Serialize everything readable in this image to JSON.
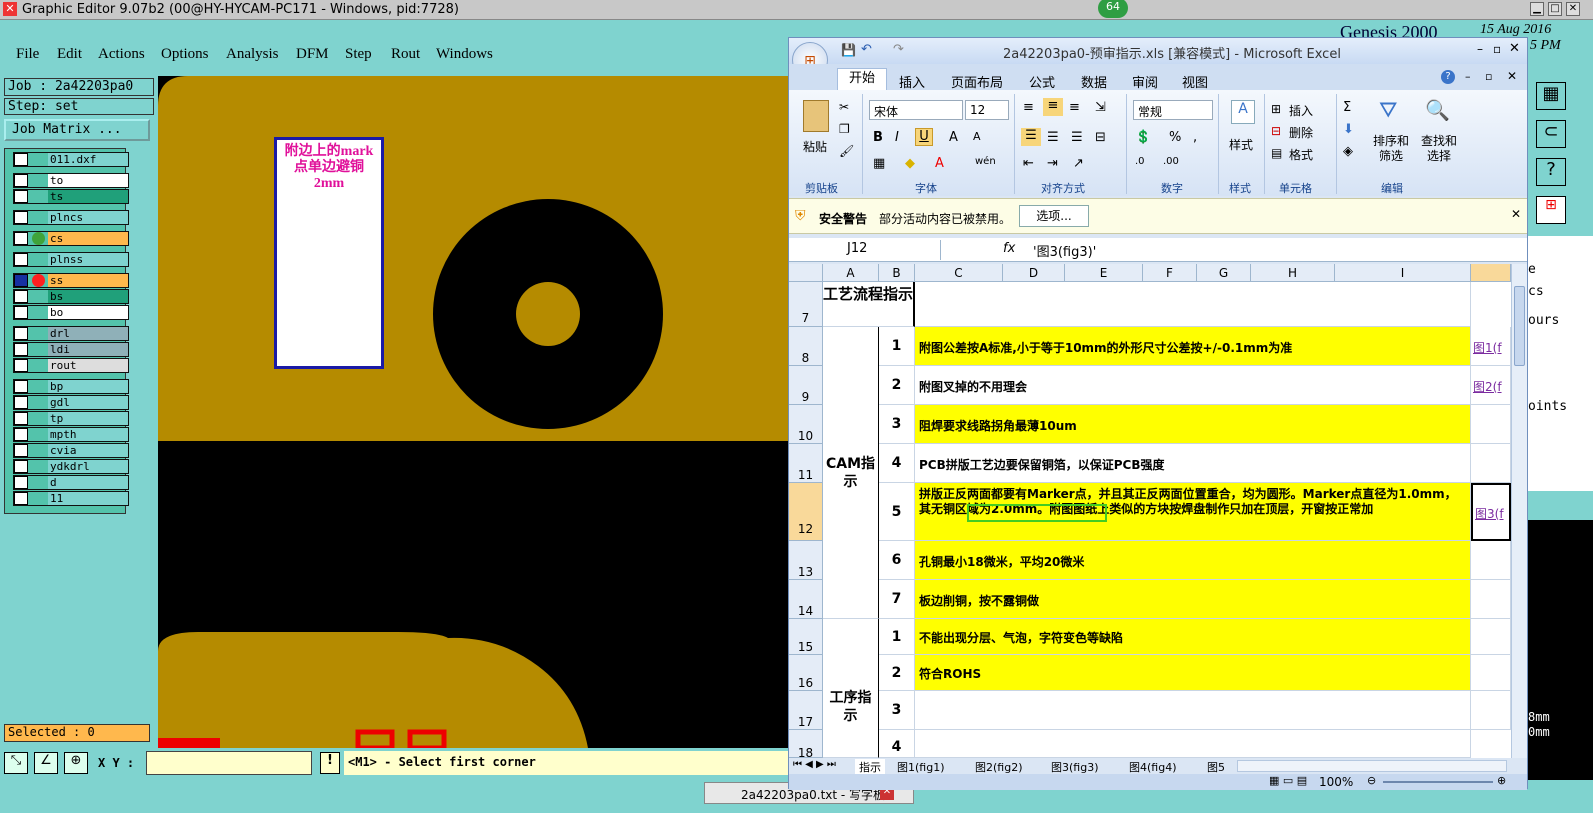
{
  "genesis": {
    "title": "Graphic Editor 9.07b2 (00@HY-HYCAM-PC171 - Windows, pid:7728)",
    "menu": [
      "File",
      "Edit",
      "Actions",
      "Options",
      "Analysis",
      "DFM",
      "Step",
      "Rout",
      "Windows"
    ],
    "badge": "64",
    "brand": "Genesis 2000",
    "date": "15 Aug 2016",
    "time": "5 PM",
    "job": "Job : 2a42203pa0",
    "step": "Step: set",
    "job_matrix": "Job Matrix ...",
    "layers": [
      "011.dxf",
      "to",
      "ts",
      "plncs",
      "cs",
      "plnss",
      "ss",
      "bs",
      "bo",
      "drl",
      "ldi",
      "rout",
      "bp",
      "gdl",
      "tp",
      "mpth",
      "cvia",
      "ydkdrl",
      "d",
      "11"
    ],
    "selected": "Selected : 0",
    "xy_label": "X Y :",
    "xy_value": "",
    "status": "<M1> - Select first corner",
    "annotation": "附边上的mark点单边避铜2mm",
    "right_fragments": [
      "e",
      "cs",
      "ours",
      "oints",
      "8mm",
      "0mm"
    ],
    "taskbar_item": "2a42203pa0.txt - 写字板"
  },
  "excel": {
    "title": "2a42203pa0-预审指示.xls  [兼容模式] - Microsoft Excel",
    "tabs": [
      "开始",
      "插入",
      "页面布局",
      "公式",
      "数据",
      "审阅",
      "视图"
    ],
    "groups": [
      "剪贴板",
      "字体",
      "对齐方式",
      "数字",
      "样式",
      "单元格",
      "编辑"
    ],
    "paste": "粘贴",
    "font_name": "宋体",
    "font_size": "12",
    "number_format": "常规",
    "styles_btn": "样式",
    "insert_btn": "插入",
    "delete_btn": "删除",
    "format_btn": "格式",
    "sort_btn": "排序和筛选",
    "find_btn": "查找和选择",
    "security_title": "安全警告",
    "security_msg": "部分活动内容已被禁用。",
    "options_btn": "选项...",
    "name_box": "J12",
    "fx": "fx",
    "formula": "'图3(fig3)'",
    "columns": [
      "A",
      "B",
      "C",
      "D",
      "E",
      "F",
      "G",
      "H",
      "I"
    ],
    "rows": [
      "7",
      "8",
      "9",
      "10",
      "11",
      "12",
      "13",
      "14",
      "15",
      "16",
      "17",
      "18"
    ],
    "header_cell": "工艺流程指示",
    "cam_label": "CAM指示",
    "proc_label": "工序指示",
    "items": [
      {
        "n": "1",
        "text": "附图公差按A标准,小于等于10mm的外形尺寸公差按+/-0.1mm为准",
        "link": "图1(f"
      },
      {
        "n": "2",
        "text": "附图叉掉的不用理会",
        "link": "图2(f"
      },
      {
        "n": "3",
        "text": "阻焊要求线路拐角最薄10um",
        "link": ""
      },
      {
        "n": "4",
        "text": "PCB拼版工艺边要保留铜箔，以保证PCB强度",
        "link": ""
      },
      {
        "n": "5",
        "text": "拼版正反两面都要有Marker点，并且其正反两面位置重合，均为圆形。Marker点直径为1.0mm，其无铜区域为2.0mm。附图图纸上类似的方块按焊盘制作只加在顶层，开窗按正常加",
        "link": "图3(f"
      },
      {
        "n": "6",
        "text": "孔铜最小18微米，平均20微米",
        "link": ""
      },
      {
        "n": "7",
        "text": "板边削铜，按不露铜做",
        "link": ""
      },
      {
        "n": "1",
        "text": "不能出现分层、气泡，字符变色等缺陷",
        "link": ""
      },
      {
        "n": "2",
        "text": "符合ROHS",
        "link": ""
      },
      {
        "n": "3",
        "text": "",
        "link": ""
      },
      {
        "n": "4",
        "text": "",
        "link": ""
      }
    ],
    "sheets": [
      "指示",
      "图1(fig1)",
      "图2(fig2)",
      "图3(fig3)",
      "图4(fig4)",
      "图5"
    ],
    "zoom": "100%"
  }
}
